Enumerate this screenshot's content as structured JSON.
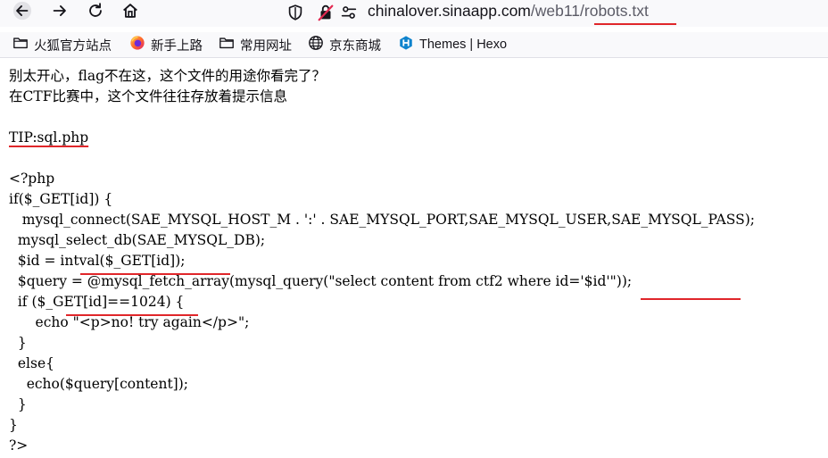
{
  "browser": {
    "url_host": "chinalover.sinaapp.com",
    "url_path_1": "/web11/",
    "url_path_2": "robots.txt",
    "accent_underline": "#e0262a"
  },
  "bookmarks": [
    {
      "label": "火狐官方站点",
      "icon": "folder-icon"
    },
    {
      "label": "新手上路",
      "icon": "firefox-icon"
    },
    {
      "label": "常用网址",
      "icon": "folder-icon"
    },
    {
      "label": "京东商城",
      "icon": "globe-icon"
    },
    {
      "label": "Themes | Hexo",
      "icon": "hexo-icon"
    }
  ],
  "page": {
    "intro1": "别太开心，flag不在这，这个文件的用途你看完了？",
    "intro2": "在CTF比赛中，这个文件往往存放着提示信息",
    "tip": "TIP:sql.php",
    "code": [
      "<?php",
      "if($_GET[id]) {",
      "   mysql_connect(SAE_MYSQL_HOST_M . ':' . SAE_MYSQL_PORT,SAE_MYSQL_USER,SAE_MYSQL_PASS);",
      "  mysql_select_db(SAE_MYSQL_DB);",
      "  $id = intval($_GET[id]);",
      "  $query = @mysql_fetch_array(mysql_query(\"select content from ctf2 where id='$id'\"));",
      "  if ($_GET[id]==1024) {",
      "      echo \"<p>no! try again</p>\";",
      "  }",
      "  else{",
      "    echo($query[content]);",
      "  }",
      "}",
      "?>"
    ]
  }
}
